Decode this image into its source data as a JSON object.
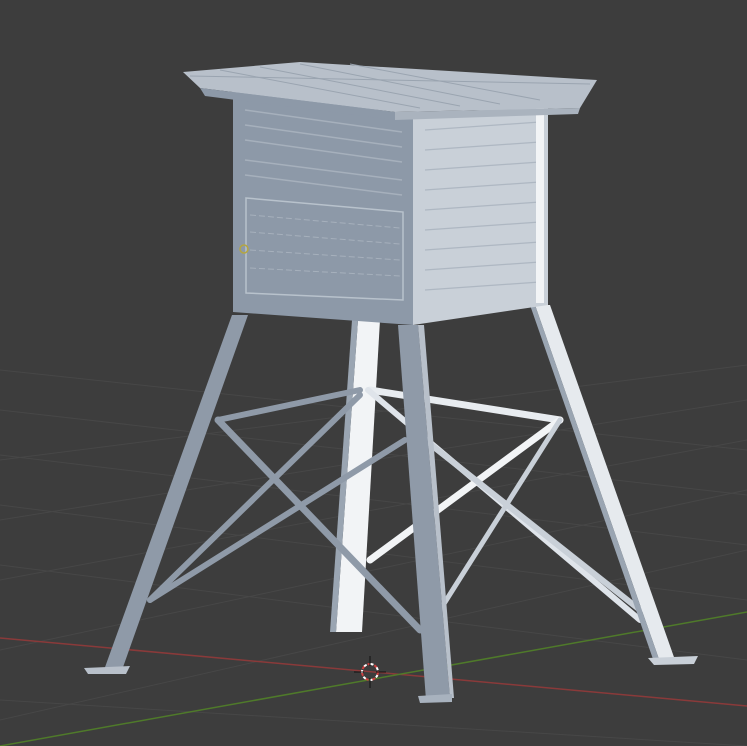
{
  "viewport": {
    "background": "#3d3d3d",
    "grid_color": "#4a4a4a",
    "x_axis_color": "#8a3a3a",
    "y_axis_color": "#4f7a2a"
  },
  "model": {
    "front_face_color": "#8d99a8",
    "side_face_color": "#c9d0d8",
    "roof_color": "#b8c0ca",
    "leg_color": "#8f9aa8",
    "lit_color": "#f2f4f6"
  },
  "icons": {
    "cursor": "3d-cursor-icon"
  }
}
